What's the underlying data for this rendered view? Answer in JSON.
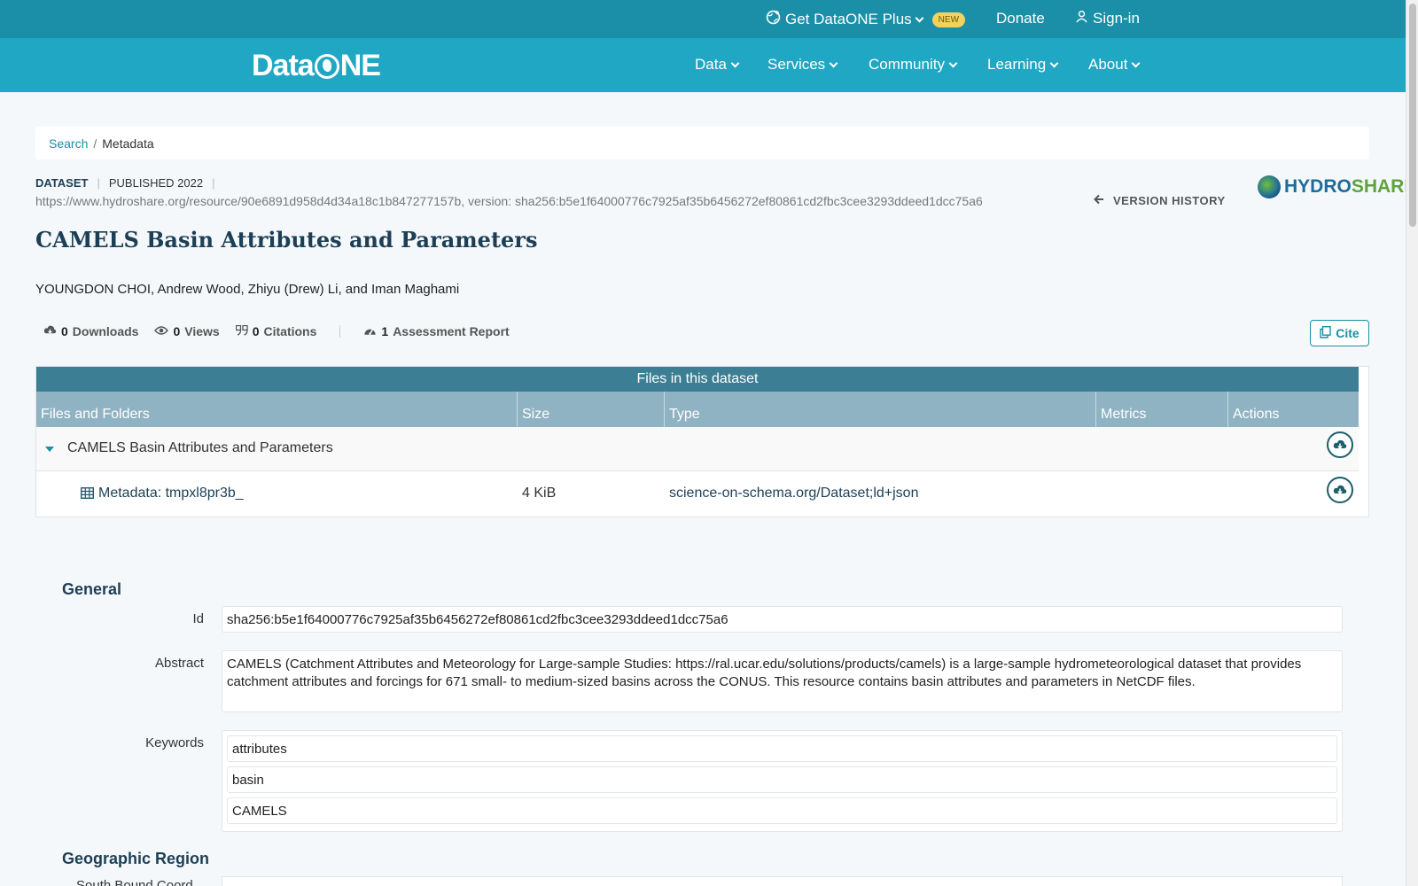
{
  "topbar": {
    "plus_label": "Get DataONE Plus",
    "new_badge": "NEW",
    "donate_label": "Donate",
    "signin_label": "Sign-in"
  },
  "nav": {
    "logo_left": "Data",
    "logo_right": "NE",
    "items": [
      "Data",
      "Services",
      "Community",
      "Learning",
      "About"
    ]
  },
  "breadcrumb": {
    "search": "Search",
    "separator": "/",
    "current": "Metadata"
  },
  "dataset": {
    "type_label": "DATASET",
    "published": "PUBLISHED 2022",
    "url_line": "https://www.hydroshare.org/resource/90e6891d958d4d34a18c1b847277157b, version: sha256:b5e1f64000776c7925af35b6456272ef80861cd2fbc3cee3293ddeed1dcc75a6",
    "version_history": "VERSION HISTORY",
    "repo_logo_a": "HYDRO",
    "repo_logo_b": "SHARE",
    "title": "CAMELS Basin Attributes and Parameters",
    "authors": "YOUNGDON CHOI, Andrew Wood, Zhiyu (Drew) Li, and Iman Maghami"
  },
  "stats": {
    "downloads_count": "0",
    "downloads_label": "Downloads",
    "views_count": "0",
    "views_label": "Views",
    "citations_count": "0",
    "citations_label": "Citations",
    "assessment_count": "1",
    "assessment_label": "Assessment Report",
    "cite_label": "Cite"
  },
  "files": {
    "title": "Files in this dataset",
    "headers": [
      "Files and Folders",
      "Size",
      "Type",
      "Metrics",
      "Actions"
    ],
    "folder_name": "CAMELS Basin Attributes and Parameters",
    "file_name": "Metadata: tmpxl8pr3b_",
    "file_size": "4 KiB",
    "file_type": "science-on-schema.org/Dataset;ld+json"
  },
  "general": {
    "heading": "General",
    "id_label": "Id",
    "id_value": "sha256:b5e1f64000776c7925af35b6456272ef80861cd2fbc3cee3293ddeed1dcc75a6",
    "abstract_label": "Abstract",
    "abstract_value": "CAMELS (Catchment Attributes and Meteorology for Large-sample Studies: https://ral.ucar.edu/solutions/products/camels) is a large-sample hydrometeorological dataset that provides catchment attributes and forcings for 671 small- to medium-sized basins across the CONUS. This resource contains basin attributes and parameters in NetCDF files.",
    "keywords_label": "Keywords",
    "keywords": [
      "attributes",
      "basin",
      "CAMELS"
    ]
  },
  "geo": {
    "heading": "Geographic Region",
    "partial_label": "South Bound Coord"
  },
  "colors": {
    "topbar": "#1a8fa7",
    "nav": "#20a7c3",
    "table_title": "#3c7e94",
    "table_head": "#8fb3c3",
    "heading": "#1d3f55"
  }
}
